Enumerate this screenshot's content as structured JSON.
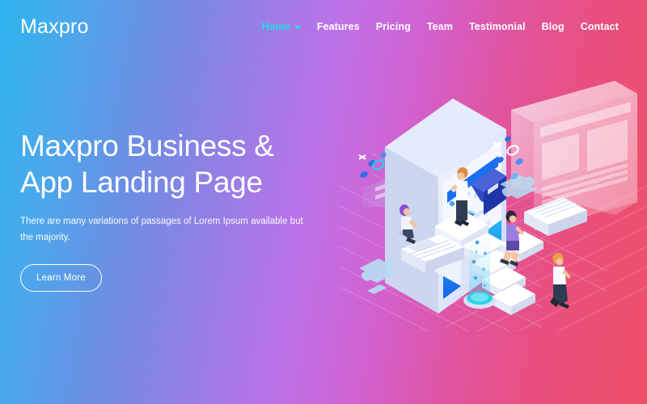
{
  "brand": {
    "logo": "Maxpro"
  },
  "nav": {
    "items": [
      {
        "label": "Home",
        "active": true,
        "has_dropdown": true
      },
      {
        "label": "Features",
        "active": false,
        "has_dropdown": false
      },
      {
        "label": "Pricing",
        "active": false,
        "has_dropdown": false
      },
      {
        "label": "Team",
        "active": false,
        "has_dropdown": false
      },
      {
        "label": "Testimonial",
        "active": false,
        "has_dropdown": false
      },
      {
        "label": "Blog",
        "active": false,
        "has_dropdown": false
      },
      {
        "label": "Contact",
        "active": false,
        "has_dropdown": false
      }
    ]
  },
  "hero": {
    "heading_line1": "Maxpro Business &",
    "heading_line2": "App Landing Page",
    "paragraph": "There are many variations of passages of Lorem Ipsum available but the majority.",
    "cta_label": "Learn More"
  },
  "illustration": {
    "alt": "isometric-app-landing-illustration",
    "elements": [
      "smartphone-mockup",
      "browser-window-card",
      "isometric-stairs",
      "person-sitting-purple-hair",
      "person-standing-pedestal",
      "person-walking-stairs",
      "person-walking-floor",
      "document-stack-left",
      "document-stack-right",
      "puzzle-piece",
      "glow-portal-cylinder",
      "pie-chart",
      "decorative-dots"
    ]
  },
  "colors": {
    "gradient_start": "#2eb4ee",
    "gradient_mid": "#bd72e8",
    "gradient_end": "#ef5068",
    "nav_active": "#1fe0e8",
    "text_on_hero": "#ffffff",
    "illus_light": "#e8ecfb",
    "illus_blue": "#1f9cf0",
    "illus_deep_blue": "#2f49c4",
    "illus_cyan": "#29d2e8"
  }
}
